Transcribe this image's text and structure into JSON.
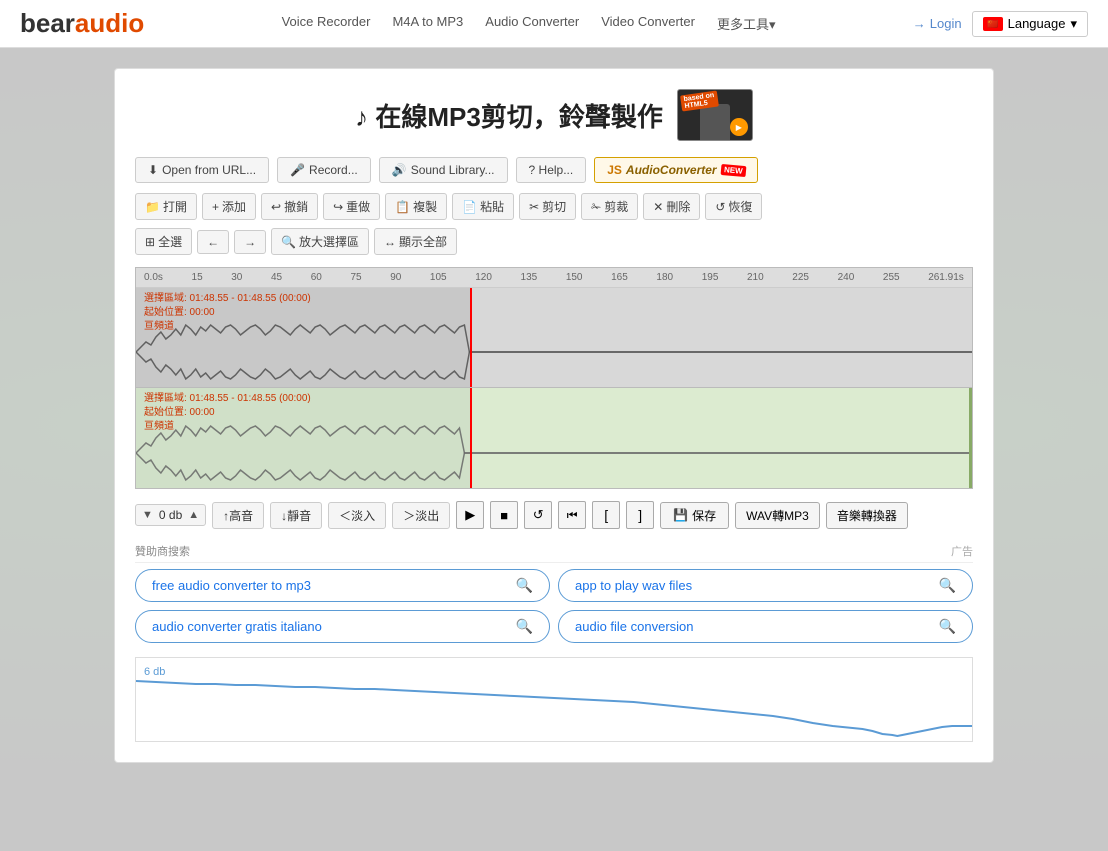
{
  "header": {
    "logo_bear": "bear",
    "logo_audio": "audio",
    "nav": [
      {
        "label": "Voice Recorder",
        "id": "voice-recorder"
      },
      {
        "label": "M4A to MP3",
        "id": "m4a-mp3"
      },
      {
        "label": "Audio Converter",
        "id": "audio-converter"
      },
      {
        "label": "Video Converter",
        "id": "video-converter"
      },
      {
        "label": "更多工具▾",
        "id": "more-tools"
      }
    ],
    "login_label": "Login",
    "language_label": "Language"
  },
  "page": {
    "title": "♪ 在線MP3剪切，鈴聲製作",
    "action_buttons": [
      {
        "label": "Open from URL...",
        "id": "open-url",
        "icon": "⬇"
      },
      {
        "label": "Record...",
        "id": "record",
        "icon": "🎤"
      },
      {
        "label": "Sound Library...",
        "id": "sound-library",
        "icon": "🔊"
      },
      {
        "label": "? Help...",
        "id": "help"
      },
      {
        "label": "JS AudioConverter",
        "id": "js-converter",
        "is_special": true
      }
    ],
    "toolbar_buttons": [
      {
        "label": "打開",
        "id": "open",
        "icon": "📁"
      },
      {
        "label": "添加",
        "id": "add",
        "icon": "+"
      },
      {
        "label": "撤銷",
        "id": "undo",
        "icon": "↩"
      },
      {
        "label": "重做",
        "id": "redo",
        "icon": "↪"
      },
      {
        "label": "複製",
        "id": "copy",
        "icon": "📋"
      },
      {
        "label": "粘貼",
        "id": "paste",
        "icon": "📄"
      },
      {
        "label": "剪切",
        "id": "cut",
        "icon": "✂"
      },
      {
        "label": "剪裁",
        "id": "trim",
        "icon": "✁"
      },
      {
        "label": "刪除",
        "id": "delete",
        "icon": "✕"
      },
      {
        "label": "恢復",
        "id": "restore",
        "icon": "↺"
      }
    ],
    "selection_buttons": [
      {
        "label": "全選",
        "id": "select-all",
        "icon": "⊞"
      },
      {
        "label": "←",
        "id": "left"
      },
      {
        "label": "→",
        "id": "right"
      },
      {
        "label": "放大選擇區",
        "id": "zoom-sel",
        "icon": "🔍"
      },
      {
        "label": "顯示全部",
        "id": "show-all",
        "icon": "↔"
      }
    ],
    "waveform": {
      "track1": {
        "info_line1": "選擇區域: 01:48.55 - 01:48.55 (00:00)",
        "info_line2": "起始位置: 00:00",
        "info_line3": "亘頻道"
      },
      "track2": {
        "info_line1": "選擇區域: 01:48.55 - 01:48.55 (00:00)",
        "info_line2": "起始位置: 00:00",
        "info_line3": "亘頻道"
      },
      "ruler_labels": [
        "0.0s",
        "15",
        "30",
        "45",
        "60",
        "75",
        "90",
        "105",
        "120",
        "135",
        "150",
        "165",
        "180",
        "195",
        "210",
        "225",
        "240",
        "255",
        "261.91s"
      ],
      "playhead_percent": 40
    },
    "controls": {
      "volume_down": "▼",
      "volume_label": "0 db",
      "volume_up": "▲",
      "treble_label": "↑高音",
      "bass_label": "↓靜音",
      "fade_in_label": "＜淡入",
      "fade_out_label": "＞淡出",
      "play_icon": "▶",
      "stop_icon": "■",
      "loop_icon": "↺",
      "start_icon": "⏮",
      "bracket_open": "[",
      "bracket_close": "]",
      "save_label": "💾保存",
      "wav_mp3_label": "WAV轉MP3",
      "music_convert_label": "音樂轉換器"
    },
    "ads": {
      "sponsor_label": "贊助商搜索",
      "ad_badge": "广告",
      "pills": [
        {
          "text": "free audio converter to mp3",
          "id": "ad-pill-1"
        },
        {
          "text": "app to play wav files",
          "id": "ad-pill-2"
        },
        {
          "text": "audio converter gratis italiano",
          "id": "ad-pill-3"
        },
        {
          "text": "audio file conversion",
          "id": "ad-pill-4"
        }
      ]
    },
    "bottom_chart": {
      "label": "6 db"
    }
  }
}
